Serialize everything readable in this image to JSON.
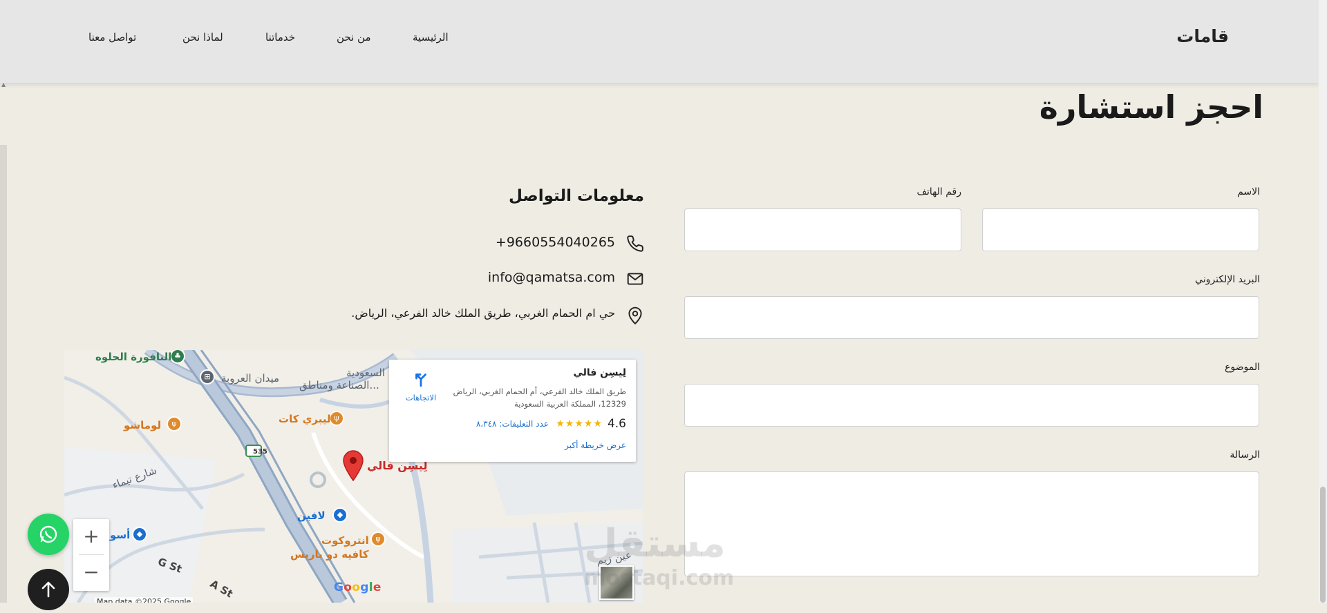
{
  "header": {
    "brand": "قامات",
    "nav": [
      {
        "label": "الرئيسية"
      },
      {
        "label": "من نحن"
      },
      {
        "label": "خدماتنا"
      },
      {
        "label": "لماذا نحن"
      },
      {
        "label": "تواصل معنا"
      }
    ]
  },
  "section": {
    "title": "احجز استشارة"
  },
  "form": {
    "name_label": "الاسم",
    "phone_label": "رقم الهاتف",
    "email_label": "البريد الإلكتروني",
    "subject_label": "الموضوع",
    "message_label": "الرسالة",
    "name_value": "",
    "phone_value": "",
    "email_value": "",
    "subject_value": "",
    "message_value": ""
  },
  "contact": {
    "title": "معلومات التواصل",
    "phone": "+9660554040265",
    "email": "info@qamatsa.com",
    "address": "حي ام الحمام الغربي، طريق الملك خالد الفرعي، الرياض."
  },
  "map": {
    "place_name": "لِيسِن فالي",
    "address": "طريق الملك خالد الفرعي، أم الحمام الغربي، الرياض 12329، المملكة العربية السعودية",
    "rating": "4.6",
    "reviews": "عدد التعليقات: ٨،٣٤٨",
    "view_larger": "عرض خريطة أكبر",
    "directions": "الاتجاهات",
    "zoom_in": "+",
    "zoom_out": "−",
    "google": "Google",
    "map_data": "Map data ©2025 Google",
    "labels": {
      "nafoura": "النافورة الحلوه",
      "midan": "ميدان العروبة",
      "saudia": "السعودية",
      "sinaa": "الصناعة ومناطق...",
      "libri": "ليبري كات",
      "lomasho": "لوماشو",
      "lysn": "لِيسِن فالي",
      "street_tima": "شارع تيماء",
      "lafeen": "لافين",
      "osto": "أسو",
      "antrokot": "انتروكوت",
      "cafe": "كافيه دو باريس",
      "gst": "G St",
      "ast": "A St",
      "ain": "عين زيم",
      "route": "535"
    }
  },
  "watermark": {
    "ar": "مستقل",
    "en": "mostaqi.com"
  }
}
